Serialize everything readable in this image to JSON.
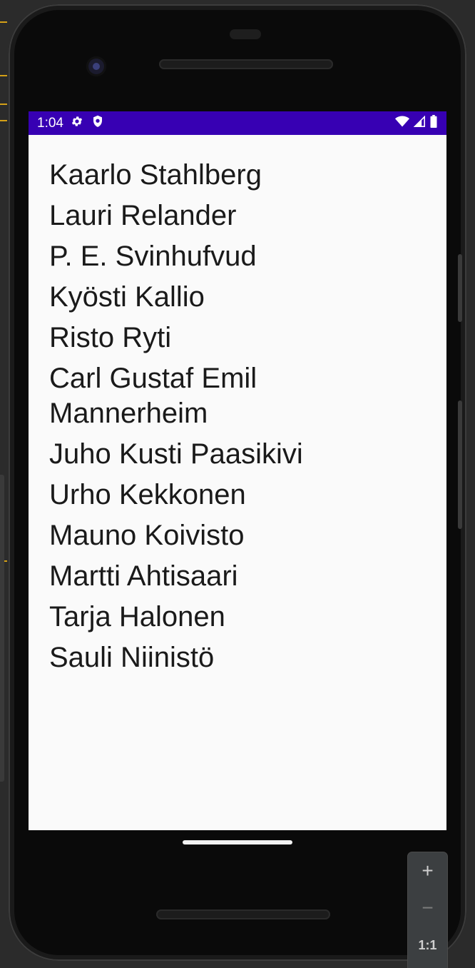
{
  "status_bar": {
    "time": "1:04",
    "left_icons": [
      "settings-gear-icon",
      "shield-icon"
    ],
    "right_icons": [
      "wifi-icon",
      "cellular-signal-icon",
      "battery-icon"
    ],
    "background": "#3700b3"
  },
  "presidents": [
    "Kaarlo Stahlberg",
    "Lauri Relander",
    "P. E. Svinhufvud",
    "Kyösti Kallio",
    "Risto Ryti",
    "Carl Gustaf Emil Mannerheim",
    "Juho Kusti Paasikivi",
    "Urho Kekkonen",
    "Mauno Koivisto",
    "Martti Ahtisaari",
    "Tarja Halonen",
    "Sauli Niinistö"
  ],
  "zoom_controls": {
    "zoom_in": "+",
    "zoom_out": "−",
    "actual_size": "1:1"
  }
}
